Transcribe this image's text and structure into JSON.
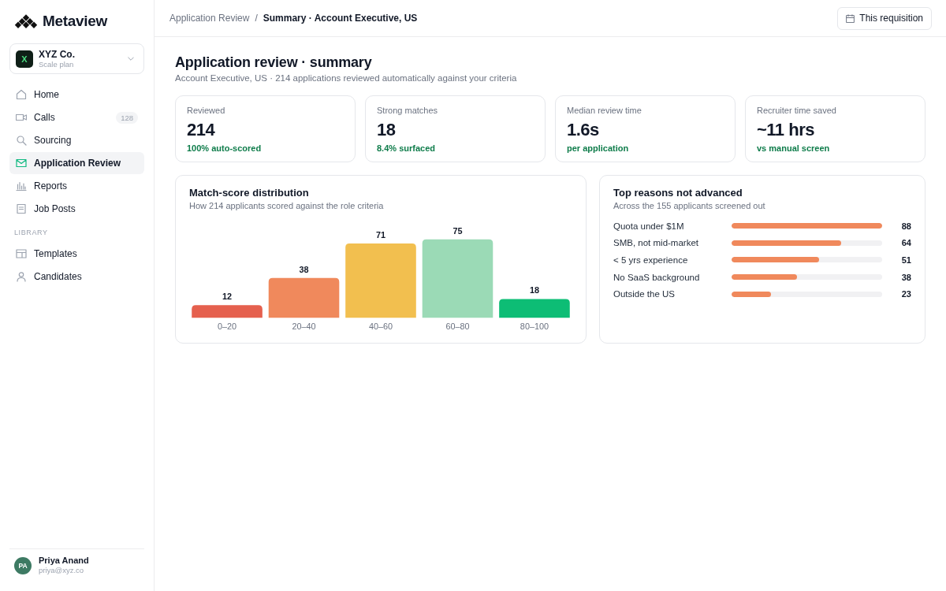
{
  "sidebar": {
    "brand": "Metaview",
    "workspace": {
      "initial": "X",
      "name": "XYZ Co.",
      "plan": "Scale plan"
    },
    "nav": [
      {
        "label": "Home",
        "selected": false
      },
      {
        "label": "Calls",
        "selected": false,
        "badge": "128"
      },
      {
        "label": "Sourcing",
        "selected": false
      },
      {
        "label": "Application Review",
        "selected": true
      },
      {
        "label": "Reports",
        "selected": false
      },
      {
        "label": "Job Posts",
        "selected": false
      }
    ],
    "library": {
      "heading": "LIBRARY",
      "items": [
        {
          "label": "Templates",
          "selected": false
        },
        {
          "label": "Candidates",
          "selected": false
        }
      ]
    },
    "user": {
      "initials": "PA",
      "name": "Priya Anand",
      "email": "priya@xyz.co"
    }
  },
  "header": {
    "breadcrumb": [
      "Application Review",
      "Summary · Account Executive, US"
    ],
    "separator": "/",
    "button": "This requisition"
  },
  "page": {
    "title": "Application review · summary",
    "subtitle": "Account Executive, US · 214 applications reviewed automatically against your criteria"
  },
  "stats": [
    {
      "label": "Reviewed",
      "value": "214",
      "note": "100% auto-scored"
    },
    {
      "label": "Strong matches",
      "value": "18",
      "note": "8.4% surfaced"
    },
    {
      "label": "Median review time",
      "value": "1.6s",
      "note": "per application"
    },
    {
      "label": "Recruiter time saved",
      "value": "~11 hrs",
      "note": "vs manual screen"
    }
  ],
  "distribution": {
    "subtitle": "How 214 applicants scored against the role criteria",
    "chart_data": {
      "type": "bar",
      "title": "Match-score distribution",
      "categories": [
        "0–20",
        "20–40",
        "40–60",
        "60–80",
        "80–100"
      ],
      "values": [
        12,
        38,
        71,
        75,
        18
      ],
      "colors": [
        "#e5604e",
        "#f0895c",
        "#f2bf4f",
        "#9bdab6",
        "#0dbd75"
      ],
      "data_labels": true
    }
  },
  "reasons": {
    "title": "Top reasons not advanced",
    "subtitle": "Across the 155 applicants screened out",
    "rows": [
      {
        "label": "Quota under $1M",
        "level": 1,
        "count": "88"
      },
      {
        "label": "SMB, not mid-market",
        "level": 0.727,
        "count": "64"
      },
      {
        "label": "< 5 yrs experience",
        "level": 0.58,
        "count": "51"
      },
      {
        "label": "No SaaS background",
        "level": 0.432,
        "count": "38"
      },
      {
        "label": "Outside the US",
        "level": 0.261,
        "count": "23"
      }
    ]
  }
}
